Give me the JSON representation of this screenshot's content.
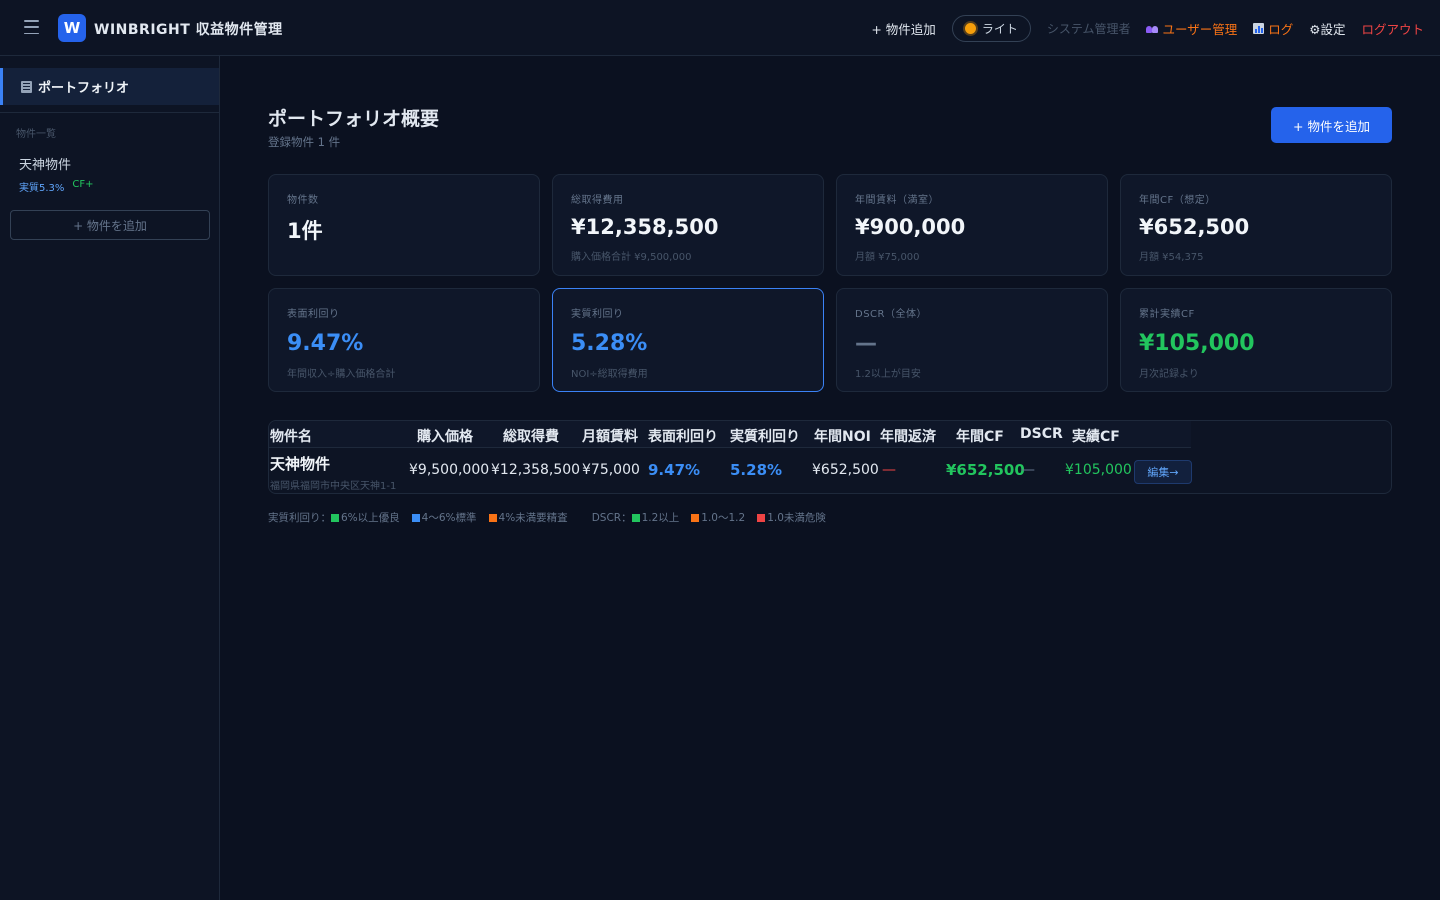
{
  "header": {
    "logo_letter": "W",
    "app_title": "WINBRIGHT 収益物件管理",
    "nav": {
      "add_property": "+ 物件追加",
      "theme": "ライト",
      "role": "システム管理者",
      "users": "ユーザー管理",
      "log": "ログ",
      "settings": "⚙設定",
      "logout": "ログアウト"
    }
  },
  "sidebar": {
    "active_item": "ポートフォリオ",
    "section_label": "物件一覧",
    "properties": [
      {
        "name": "天神物件",
        "yield": "実質5.3%",
        "cf": "CF+"
      }
    ],
    "add_button": "+ 物件を追加"
  },
  "main": {
    "title": "ポートフォリオ概要",
    "subtitle": "登録物件 1 件",
    "add_button": "+ 物件を追加",
    "cards": [
      {
        "label": "物件数",
        "value": "1件",
        "note": ""
      },
      {
        "label": "総取得費用",
        "value": "¥12,358,500",
        "note": "購入価格合計 ¥9,500,000"
      },
      {
        "label": "年間賃料（満室）",
        "value": "¥900,000",
        "note": "月額 ¥75,000"
      },
      {
        "label": "年間CF（想定）",
        "value": "¥652,500",
        "note": "月額 ¥54,375"
      },
      {
        "label": "表面利回り",
        "value": "9.47%",
        "note": "年間収入÷購入価格合計"
      },
      {
        "label": "実質利回り",
        "value": "5.28%",
        "note": "NOI÷総取得費用"
      },
      {
        "label": "DSCR（全体）",
        "value": "—",
        "note": "1.2以上が目安"
      },
      {
        "label": "累計実績CF",
        "value": "¥105,000",
        "note": "月次記録より"
      }
    ],
    "table": {
      "columns": [
        "物件名",
        "購入価格",
        "総取得費",
        "月額賃料",
        "表面利回り",
        "実質利回り",
        "年間NOI",
        "年間返済",
        "年間CF",
        "DSCR",
        "実績CF"
      ],
      "rows": [
        {
          "name": "天神物件",
          "address": "福岡県福岡市中央区天神1-1",
          "purchase_price": "¥9,500,000",
          "total_cost": "¥12,358,500",
          "monthly_rent": "¥75,000",
          "gross_yield": "9.47%",
          "net_yield": "5.28%",
          "noi": "¥652,500",
          "repayment": "—",
          "annual_cf": "¥652,500",
          "dscr": "—",
          "actual_cf": "¥105,000",
          "edit": "編集→"
        }
      ]
    },
    "legend": {
      "yield_title": "実質利回り：",
      "yield_good": "6%以上優良",
      "yield_std": "4〜6%標準",
      "yield_check": "4%未満要精査",
      "dscr_title": "DSCR：",
      "dscr_good": "1.2以上",
      "dscr_mid": "1.0〜1.2",
      "dscr_bad": "1.0未満危険"
    }
  },
  "colors": {
    "accent": "#2563eb",
    "good": "#22c55e",
    "standard": "#3b8ef6",
    "warning": "#f97316",
    "danger": "#ef4444"
  }
}
